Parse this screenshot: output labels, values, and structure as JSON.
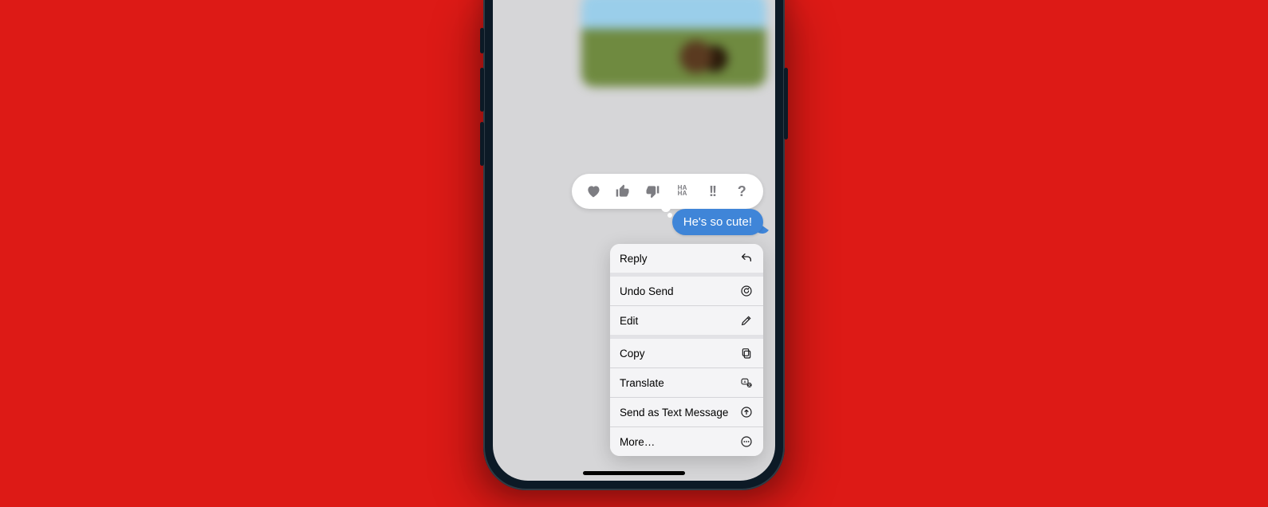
{
  "message": {
    "text": "He's so cute!"
  },
  "tapbacks": {
    "heart": "heart",
    "thumbs_up": "thumbs-up",
    "thumbs_down": "thumbs-down",
    "haha_line1": "HA",
    "haha_line2": "HA",
    "exclaim": "!!",
    "question": "?"
  },
  "menu": {
    "reply": "Reply",
    "undo_send": "Undo Send",
    "edit": "Edit",
    "copy": "Copy",
    "translate": "Translate",
    "send_as_text": "Send as Text Message",
    "more": "More…"
  }
}
